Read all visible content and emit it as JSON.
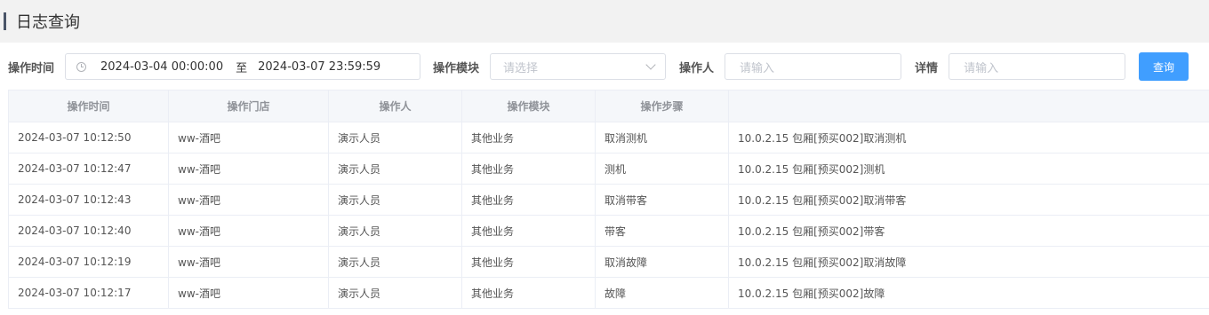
{
  "header": {
    "title": "日志查询"
  },
  "filters": {
    "time_label": "操作时间",
    "start_date": "2024-03-04 00:00:00",
    "range_sep": "至",
    "end_date": "2024-03-07 23:59:59",
    "module_label": "操作模块",
    "module_placeholder": "请选择",
    "operator_label": "操作人",
    "operator_placeholder": "请输入",
    "detail_label": "详情",
    "detail_placeholder": "请输入",
    "query_button": "查询"
  },
  "table": {
    "columns": [
      "操作时间",
      "操作门店",
      "操作人",
      "操作模块",
      "操作步骤",
      ""
    ],
    "rows": [
      [
        "2024-03-07 10:12:50",
        "ww-酒吧",
        "演示人员",
        "其他业务",
        "取消测机",
        "10.0.2.15 包厢[预买002]取消测机"
      ],
      [
        "2024-03-07 10:12:47",
        "ww-酒吧",
        "演示人员",
        "其他业务",
        "测机",
        "10.0.2.15 包厢[预买002]测机"
      ],
      [
        "2024-03-07 10:12:43",
        "ww-酒吧",
        "演示人员",
        "其他业务",
        "取消带客",
        "10.0.2.15 包厢[预买002]取消带客"
      ],
      [
        "2024-03-07 10:12:40",
        "ww-酒吧",
        "演示人员",
        "其他业务",
        "带客",
        "10.0.2.15 包厢[预买002]带客"
      ],
      [
        "2024-03-07 10:12:19",
        "ww-酒吧",
        "演示人员",
        "其他业务",
        "取消故障",
        "10.0.2.15 包厢[预买002]取消故障"
      ],
      [
        "2024-03-07 10:12:17",
        "ww-酒吧",
        "演示人员",
        "其他业务",
        "故障",
        "10.0.2.15 包厢[预买002]故障"
      ]
    ]
  }
}
